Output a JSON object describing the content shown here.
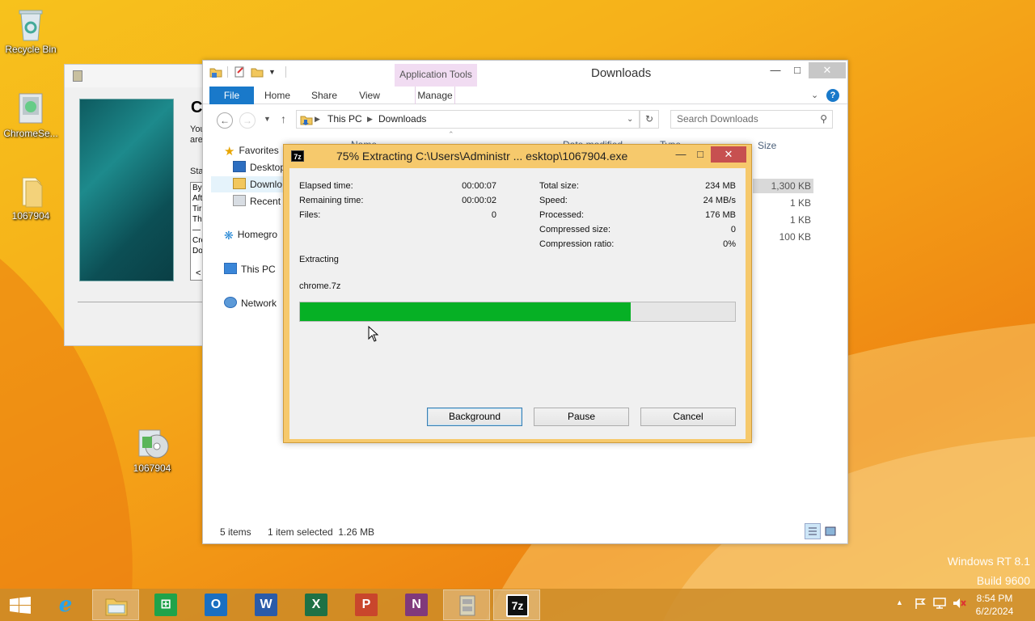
{
  "desktop": {
    "icons": [
      {
        "label": "Recycle Bin"
      },
      {
        "label": "ChromeSe..."
      },
      {
        "label": "1067904"
      },
      {
        "label": "1067904"
      }
    ],
    "watermark_line1": "Windows RT 8.1",
    "watermark_line2": "Build 9600"
  },
  "bg_window": {
    "heading": "C",
    "lines": [
      "You",
      "are"
    ],
    "status_label": "Sta",
    "log": [
      "By",
      "Aft",
      "Tir",
      "Th",
      "—",
      "Cre",
      "Do"
    ],
    "scroll_left": "<"
  },
  "explorer": {
    "title": "Downloads",
    "app_tools": "Application Tools",
    "tabs": {
      "file": "File",
      "home": "Home",
      "share": "Share",
      "view": "View",
      "manage": "Manage"
    },
    "address": {
      "this_pc": "This PC",
      "downloads": "Downloads"
    },
    "search_placeholder": "Search Downloads",
    "nav": {
      "favorites": "Favorites",
      "desktop": "Desktop",
      "downloads": "Downlo",
      "recent": "Recent p",
      "homegroup": "Homegro",
      "thispc": "This PC",
      "network": "Network"
    },
    "columns": {
      "name": "Name",
      "date": "Date modified",
      "type": "Type",
      "size": "Size"
    },
    "sizes": [
      "1,300 KB",
      "1 KB",
      "1 KB",
      "100 KB"
    ],
    "status": {
      "items": "5 items",
      "selected": "1 item selected  1.26 MB"
    }
  },
  "zip": {
    "title": "75% Extracting C:\\Users\\Administr ... esktop\\1067904.exe",
    "left": [
      {
        "label": "Elapsed time:",
        "value": "00:00:07"
      },
      {
        "label": "Remaining time:",
        "value": "00:00:02"
      },
      {
        "label": "Files:",
        "value": "0"
      }
    ],
    "right": [
      {
        "label": "Total size:",
        "value": "234 MB"
      },
      {
        "label": "Speed:",
        "value": "24 MB/s"
      },
      {
        "label": "Processed:",
        "value": "176 MB"
      },
      {
        "label": "Compressed size:",
        "value": "0"
      },
      {
        "label": "Compression ratio:",
        "value": "0%"
      }
    ],
    "operation": "Extracting",
    "current_file": "chrome.7z",
    "progress": 0.76,
    "buttons": {
      "background": "Background",
      "pause": "Pause",
      "cancel": "Cancel"
    },
    "colors": {
      "progress": "#06b025",
      "frame": "#f6c96c"
    }
  },
  "taskbar": {
    "apps": [
      "ie-icon",
      "file-explorer-icon",
      "store-icon",
      "outlook-icon",
      "word-icon",
      "excel-icon",
      "powerpoint-icon",
      "onenote-icon",
      "installer-icon",
      "7zip-icon"
    ],
    "sevenzip_label": "7z",
    "time": "8:54 PM",
    "date": "6/2/2024"
  }
}
